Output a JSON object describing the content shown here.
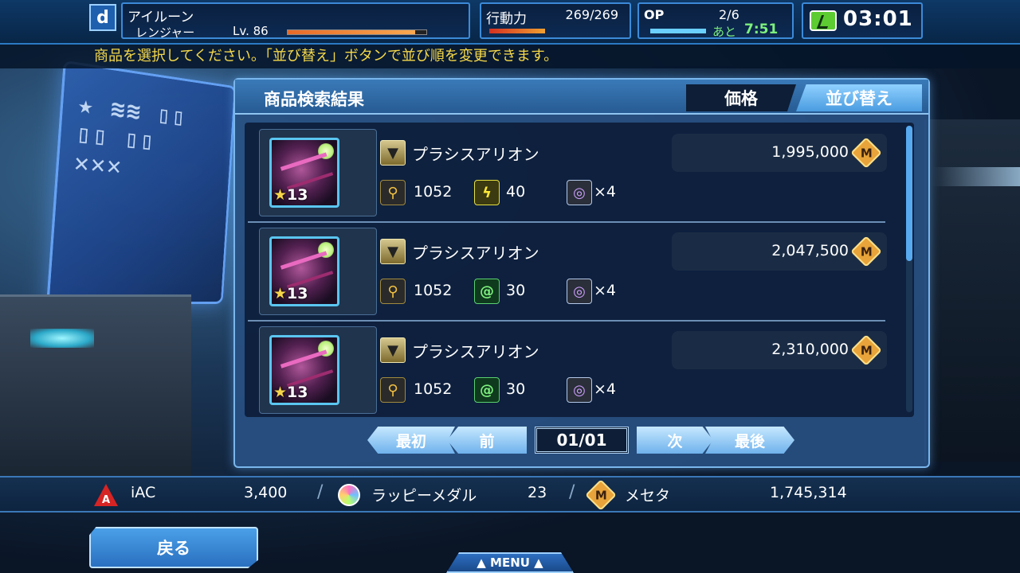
{
  "hud": {
    "character_icon": "d",
    "character_name": "アイルーン",
    "character_class": "レンジャー",
    "level": "Lv. 86",
    "level_progress": 0.92,
    "action_points_label": "行動力",
    "action_points": "269/269",
    "op_label": "OP",
    "op_value": "2/6",
    "op_remain_label": "あと",
    "op_remain_time": "7:51",
    "clock": "03:01"
  },
  "instruction": "商品を選択してください。「並び替え」ボタンで並び順を変更できます。",
  "panel": {
    "title": "商品検索結果",
    "tab_price": "価格",
    "tab_sort": "並び替え"
  },
  "items": [
    {
      "name": "プラシスアリオン",
      "rarity_symbol": "★",
      "rarity": "13",
      "price": "1,995,000",
      "attack": "1052",
      "element_icon": "lightning-icon",
      "element_value": "40",
      "slots": "×4"
    },
    {
      "name": "プラシスアリオン",
      "rarity_symbol": "★",
      "rarity": "13",
      "price": "2,047,500",
      "attack": "1052",
      "element_icon": "wind-icon",
      "element_value": "30",
      "slots": "×4"
    },
    {
      "name": "プラシスアリオン",
      "rarity_symbol": "★",
      "rarity": "13",
      "price": "2,310,000",
      "attack": "1052",
      "element_icon": "wind-icon",
      "element_value": "30",
      "slots": "×4"
    }
  ],
  "pager": {
    "first": "最初",
    "prev": "前",
    "count": "01/01",
    "next": "次",
    "last": "最後"
  },
  "currencies": {
    "iac_icon_letter": "A",
    "iac_label": "iAC",
    "iac_value": "3,400",
    "separator": "/",
    "medal_label": "ラッピーメダル",
    "medal_value": "23",
    "meseta_symbol": "M",
    "meseta_label": "メセタ",
    "meseta_value": "1,745,314"
  },
  "buttons": {
    "back": "戻る",
    "menu": "▲ MENU ▲"
  },
  "colors": {
    "instruction_text": "#f5d84a",
    "remaining_time": "#7df07d",
    "meseta": "#e8a43a"
  }
}
